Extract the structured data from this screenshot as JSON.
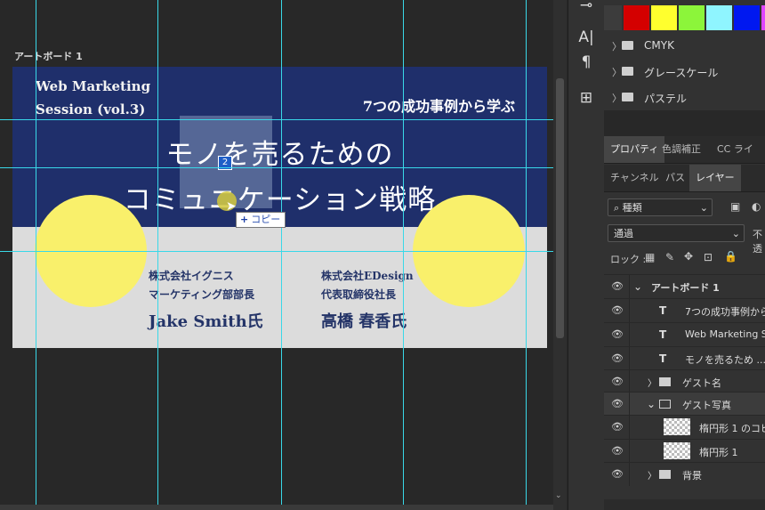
{
  "canvas": {
    "artboard_label": "アートボード 1",
    "design": {
      "heading_line1": "Web Marketing",
      "heading_line2": "Session (vol.3)",
      "tagline": "7つの成功事例から学ぶ",
      "title_line1": "モノを売るための",
      "title_line2": "コミュニケーション戦略",
      "guest1": {
        "company": "株式会社イグニス",
        "role": "マーケティング部部長",
        "name": "Jake Smith氏"
      },
      "guest2": {
        "company": "株式会社EDesign",
        "role": "代表取締役社長",
        "name": "高橋 春香氏"
      },
      "bg_top_color": "#1f2f6b",
      "bg_bottom_color": "#dcdcdc",
      "circle_color": "#f9f06b"
    },
    "drag_badge": "2",
    "copy_tooltip": {
      "icon": "+",
      "label": "コピー"
    }
  },
  "tools": [
    {
      "name": "tool-top-icon",
      "glyph": "⊸"
    },
    {
      "name": "vertical-type-icon",
      "glyph": "A|"
    },
    {
      "name": "paragraph-icon",
      "glyph": "¶"
    },
    {
      "name": "crop-artboard-icon",
      "glyph": "⊞"
    }
  ],
  "swatches": {
    "colors": [
      "#d40000",
      "#ffff2e",
      "#8cf53a",
      "#8ff5ff",
      "#0018f0",
      "#e046ff"
    ],
    "groups": [
      "CMYK",
      "グレースケール",
      "パステル"
    ]
  },
  "props_tabs": [
    "プロパティ",
    "色調補正",
    "CC ライブラリ"
  ],
  "layer_tabs": [
    "チャンネル",
    "パス",
    "レイヤー"
  ],
  "layers_panel": {
    "filter_label": "種類",
    "blend_mode": "通過",
    "opacity_label": "不透",
    "lock_label": "ロック :",
    "rows": [
      {
        "name": "layer-artboard",
        "label": "アートボード 1"
      },
      {
        "name": "layer-tagline",
        "label": "7つの成功事例から"
      },
      {
        "name": "layer-web-marketing",
        "label": "Web Marketing Se"
      },
      {
        "name": "layer-title",
        "label": "モノを売るため ...ケ"
      },
      {
        "name": "layer-guest-name",
        "label": "ゲスト名"
      },
      {
        "name": "layer-guest-photo",
        "label": "ゲスト写真"
      },
      {
        "name": "layer-ellipse-copy",
        "label": "楕円形 1 のコピ"
      },
      {
        "name": "layer-ellipse",
        "label": "楕円形 1"
      },
      {
        "name": "layer-background",
        "label": "背景"
      }
    ]
  }
}
